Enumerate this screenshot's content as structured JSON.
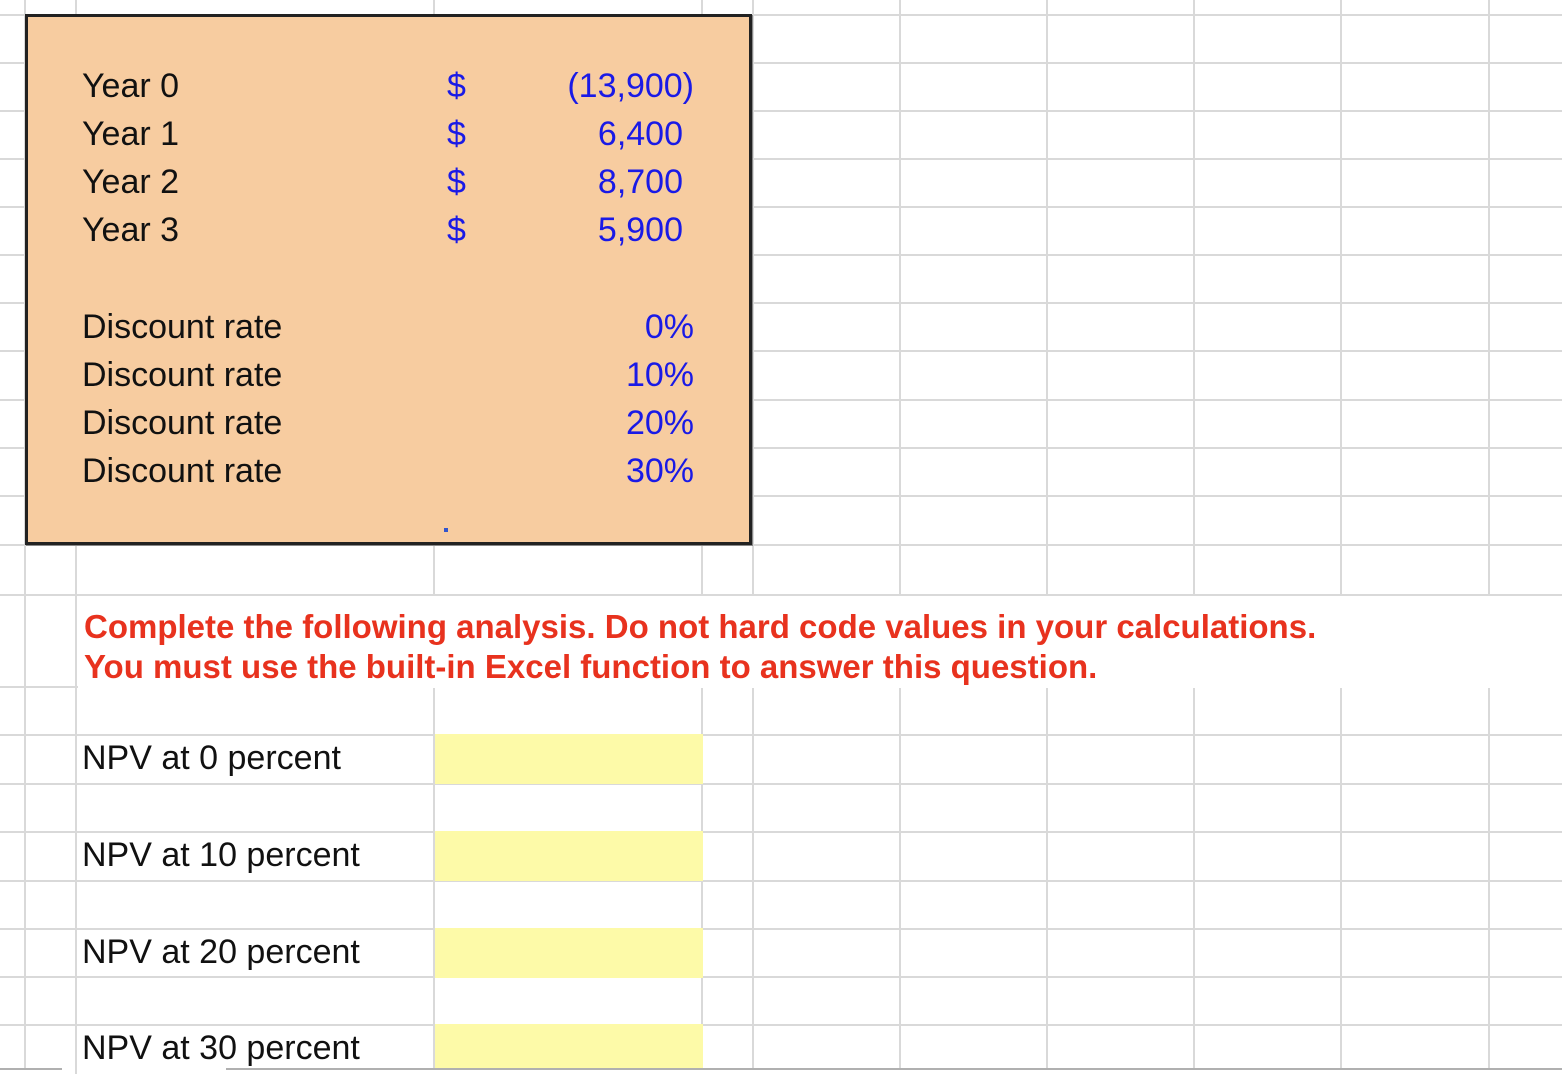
{
  "cash_flows": [
    {
      "label": "Year 0",
      "currency": "$",
      "value": "(13,900)"
    },
    {
      "label": "Year 1",
      "currency": "$",
      "value": "6,400"
    },
    {
      "label": "Year 2",
      "currency": "$",
      "value": "8,700"
    },
    {
      "label": "Year 3",
      "currency": "$",
      "value": "5,900"
    }
  ],
  "discount_rates": [
    {
      "label": "Discount rate",
      "value": "0%"
    },
    {
      "label": "Discount rate",
      "value": "10%"
    },
    {
      "label": "Discount rate",
      "value": "20%"
    },
    {
      "label": "Discount rate",
      "value": "30%"
    }
  ],
  "instructions": {
    "line1": "Complete the following analysis. Do not hard code values in your calculations.",
    "line2": "You must use the built-in Excel function to answer this question."
  },
  "npv_rows": [
    {
      "label": "NPV at 0 percent",
      "value": ""
    },
    {
      "label": "NPV at 10 percent",
      "value": ""
    },
    {
      "label": "NPV at 20 percent",
      "value": ""
    },
    {
      "label": "NPV at 30 percent",
      "value": ""
    }
  ],
  "colors": {
    "input_fill": "#f7cca0",
    "input_value": "#1a1ae6",
    "instruction": "#e8321e",
    "answer_fill": "#fdfaa8",
    "gridline": "#d9d9d9"
  }
}
